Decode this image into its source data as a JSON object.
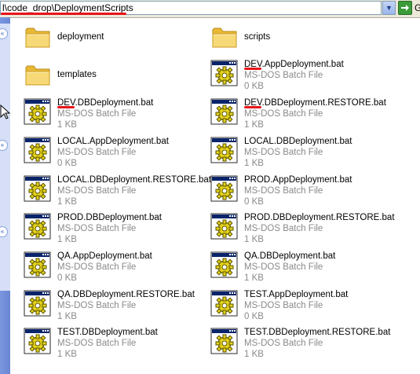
{
  "address": {
    "path": "l\\code_drop\\DeploymentScripts",
    "go_label": "G"
  },
  "colors": {
    "annotation_red": "#e8131a",
    "taskpane_blue": "#7a96df",
    "folder_yellow": "#f6d66b"
  },
  "folders": [
    {
      "name": "deployment",
      "icon": "folder-icon"
    },
    {
      "name": "scripts",
      "icon": "folder-icon"
    },
    {
      "name": "templates",
      "icon": "folder-icon"
    }
  ],
  "files": [
    {
      "name": "DEV.AppDeployment.bat",
      "type": "MS-DOS Batch File",
      "size": "0 KB",
      "icon": "batch-file-icon"
    },
    {
      "name": "DEV.DBDeployment.bat",
      "type": "MS-DOS Batch File",
      "size": "1 KB",
      "icon": "batch-file-icon"
    },
    {
      "name": "DEV.DBDeployment.RESTORE.bat",
      "type": "MS-DOS Batch File",
      "size": "1 KB",
      "icon": "batch-file-icon"
    },
    {
      "name": "LOCAL.AppDeployment.bat",
      "type": "MS-DOS Batch File",
      "size": "0 KB",
      "icon": "batch-file-icon"
    },
    {
      "name": "LOCAL.DBDeployment.bat",
      "type": "MS-DOS Batch File",
      "size": "1 KB",
      "icon": "batch-file-icon"
    },
    {
      "name": "LOCAL.DBDeployment.RESTORE.bat",
      "type": "MS-DOS Batch File",
      "size": "1 KB",
      "icon": "batch-file-icon"
    },
    {
      "name": "PROD.AppDeployment.bat",
      "type": "MS-DOS Batch File",
      "size": "0 KB",
      "icon": "batch-file-icon"
    },
    {
      "name": "PROD.DBDeployment.bat",
      "type": "MS-DOS Batch File",
      "size": "1 KB",
      "icon": "batch-file-icon"
    },
    {
      "name": "PROD.DBDeployment.RESTORE.bat",
      "type": "MS-DOS Batch File",
      "size": "1 KB",
      "icon": "batch-file-icon"
    },
    {
      "name": "QA.AppDeployment.bat",
      "type": "MS-DOS Batch File",
      "size": "0 KB",
      "icon": "batch-file-icon"
    },
    {
      "name": "QA.DBDeployment.bat",
      "type": "MS-DOS Batch File",
      "size": "1 KB",
      "icon": "batch-file-icon"
    },
    {
      "name": "QA.DBDeployment.RESTORE.bat",
      "type": "MS-DOS Batch File",
      "size": "1 KB",
      "icon": "batch-file-icon"
    },
    {
      "name": "TEST.AppDeployment.bat",
      "type": "MS-DOS Batch File",
      "size": "0 KB",
      "icon": "batch-file-icon"
    },
    {
      "name": "TEST.DBDeployment.bat",
      "type": "MS-DOS Batch File",
      "size": "1 KB",
      "icon": "batch-file-icon"
    },
    {
      "name": "TEST.DBDeployment.RESTORE.bat",
      "type": "MS-DOS Batch File",
      "size": "1 KB",
      "icon": "batch-file-icon"
    }
  ]
}
